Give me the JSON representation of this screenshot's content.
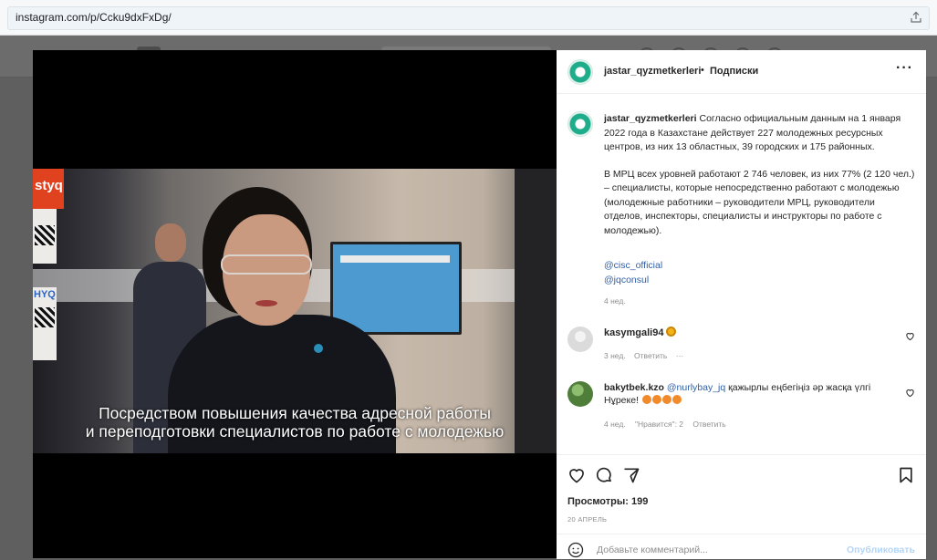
{
  "browser": {
    "url": "instagram.com/p/Ccku9dxFxDg/"
  },
  "post": {
    "username": "jastar_qyzmetkerleri",
    "separator": "•",
    "follow_label": "Подписки",
    "more_label": "···",
    "caption_p1": "Согласно официальным данным на 1 января 2022 года в Казахстане действует 227 молодежных ресурсных центров, из них 13 областных, 39 городских и 175 районных.",
    "caption_p2": "В МРЦ всех уровней работают 2 746 человек, из них 77% (2 120 чел.) – специалисты, которые непосредственно работают с молодежью (молодежные работники – руководители МРЦ, руководители отделов, инспекторы, специалисты и инструкторы по работе с молодежью).",
    "mention_1": "@cisc_official",
    "mention_2": "@jqconsul",
    "caption_age": "4 нед."
  },
  "media": {
    "subtitle_line1": "Посредством повышения качества адресной работы",
    "subtitle_line2": "и переподготовки специалистов по работе с молодежью",
    "sign_text": "styq",
    "sign_text2": "HYQ"
  },
  "comments": [
    {
      "username": "kasymgali94",
      "age": "3 нед.",
      "reply_label": "Ответить",
      "more_label": "···"
    },
    {
      "username": "bakytbek.kzo",
      "mention": "@nurlybay_jq",
      "text": "қажырлы еңбегіңіз әр жасқа үлгі Нұреке!",
      "age": "4 нед.",
      "likes_label": "\"Нравится\": 2",
      "reply_label": "Ответить"
    }
  ],
  "footer": {
    "views_label": "Просмотры: 199",
    "date_label": "20 АПРЕЛЬ",
    "comment_placeholder": "Добавьте комментарий...",
    "post_label": "Опубликовать"
  },
  "colors": {
    "accent_link": "#2f5ea5",
    "post_disabled": "#b3d5f7",
    "avatar_green": "#1eac8a"
  }
}
